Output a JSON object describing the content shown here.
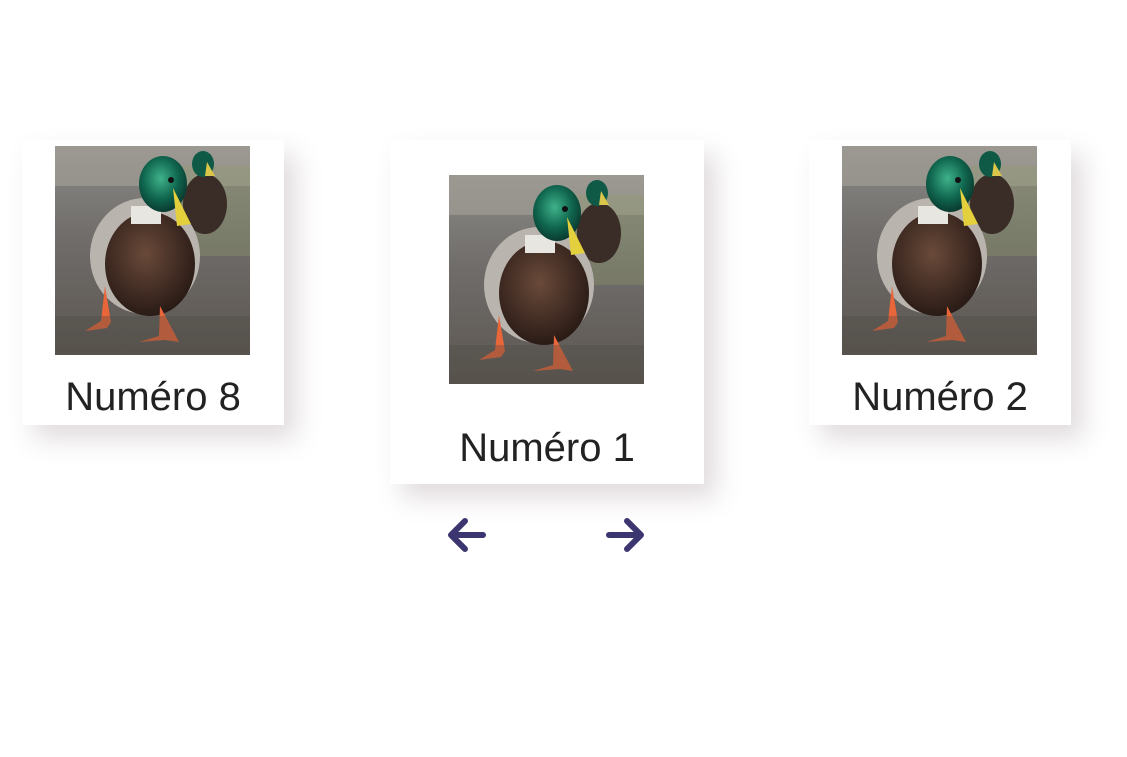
{
  "carousel": {
    "accent_color": "#3c3670",
    "cards": [
      {
        "position": "left",
        "caption": "Numéro 8",
        "image": "mallard-duck-photo"
      },
      {
        "position": "center",
        "caption": "Numéro 1",
        "image": "mallard-duck-photo"
      },
      {
        "position": "right",
        "caption": "Numéro 2",
        "image": "mallard-duck-photo"
      }
    ],
    "controls": {
      "prev_icon": "arrow-left-icon",
      "next_icon": "arrow-right-icon"
    }
  }
}
